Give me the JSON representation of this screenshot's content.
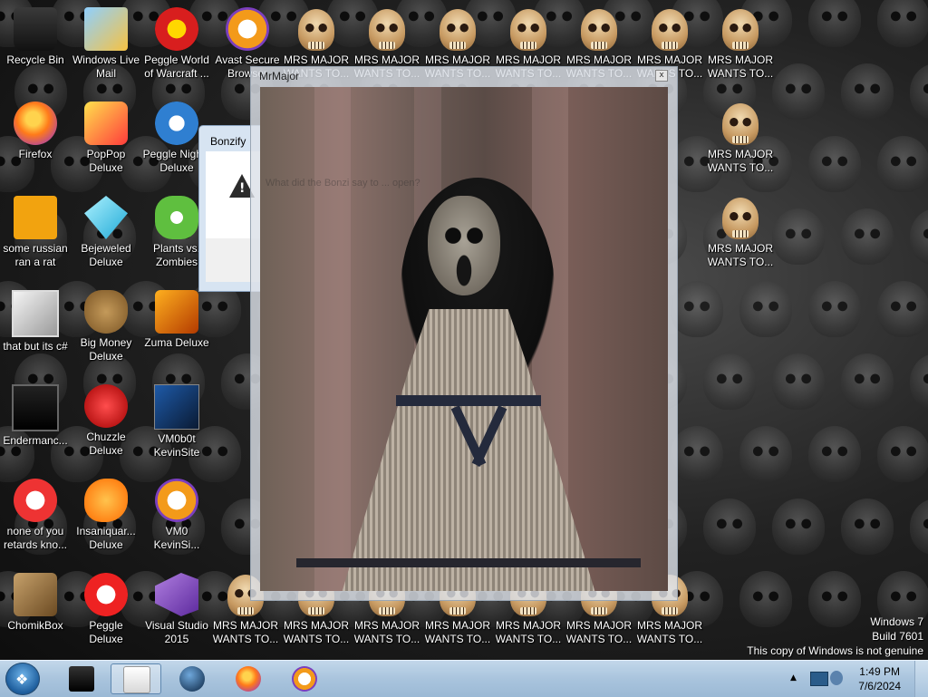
{
  "desktop": {
    "icons": [
      {
        "label": "Recycle Bin"
      },
      {
        "label": "Windows Live\nMail"
      },
      {
        "label": "Peggle World\nof Warcraft ..."
      },
      {
        "label": "Avast Secure\nBrowser"
      },
      {
        "label": "Firefox"
      },
      {
        "label": "PopPop\nDeluxe"
      },
      {
        "label": "Peggle Nights\nDeluxe"
      },
      {
        "label": "some russian\nran a rat"
      },
      {
        "label": "Bejeweled\nDeluxe"
      },
      {
        "label": "Plants vs.\nZombies"
      },
      {
        "label": "that but its c#"
      },
      {
        "label": "Big Money\nDeluxe"
      },
      {
        "label": "Zuma Deluxe"
      },
      {
        "label": "Endermanc..."
      },
      {
        "label": "Chuzzle\nDeluxe"
      },
      {
        "label": "VM0b0t\nKevinSite"
      },
      {
        "label": "none of you\nretards kno..."
      },
      {
        "label": "Insaniquar...\nDeluxe"
      },
      {
        "label": "VM0\nKevinSi..."
      },
      {
        "label": "ChomikBox"
      },
      {
        "label": "Peggle Deluxe"
      },
      {
        "label": "Visual Studio\n2015"
      }
    ],
    "skull_label": "MRS MAJOR\nWANTS TO..."
  },
  "bonzify_dialog": {
    "title": "Bonzify"
  },
  "mrmajor_window": {
    "title": "MrMajor",
    "close": "x",
    "faded_text": "What did the Bonzi say to ... open?"
  },
  "taskbar": {
    "start_icon": "windows-orb"
  },
  "clock": {
    "time": "1:49 PM",
    "date": "7/6/2024"
  },
  "watermark": {
    "line1": "Windows 7",
    "line2": "Build 7601",
    "line3": "This copy of Windows is not genuine"
  }
}
